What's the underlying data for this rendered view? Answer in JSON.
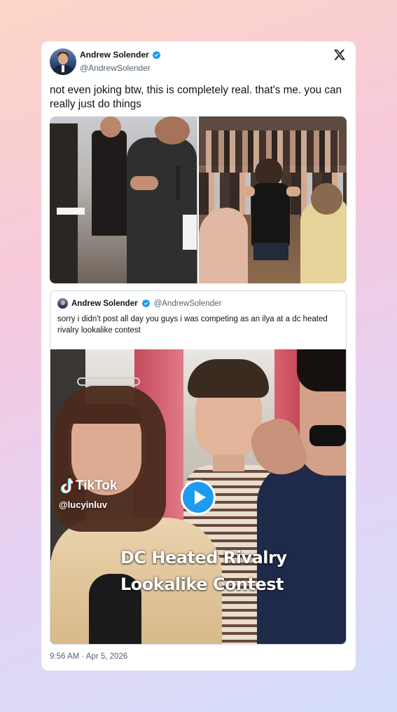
{
  "tweet": {
    "author_name": "Andrew Solender",
    "author_handle": "@AndrewSolender",
    "verified": true,
    "platform_icon": "x-logo-icon",
    "text": "not even joking btw, this is completely real. that's me. you can really just do things",
    "timestamp": "9:56 AM · Apr 5, 2026"
  },
  "media": {
    "photos": [
      {
        "description_icon": "photo-crowd-left"
      },
      {
        "description_icon": "photo-crowd-right"
      }
    ]
  },
  "quote": {
    "author_name": "Andrew Solender",
    "author_handle": "@AndrewSolender",
    "verified": true,
    "text": "sorry i didn't post all day you guys i was competing as an ilya at a dc heated rivalry lookalike contest",
    "video": {
      "watermark_brand": "TikTok",
      "watermark_user": "@lucyinluv",
      "caption_line1": "DC Heated Rivalry",
      "caption_line2": "Lookalike Contest",
      "play_icon": "play-icon"
    }
  },
  "colors": {
    "accent": "#1d9bf0",
    "text": "#0f1419",
    "secondary_text": "#536471",
    "border": "#cfd9de"
  }
}
